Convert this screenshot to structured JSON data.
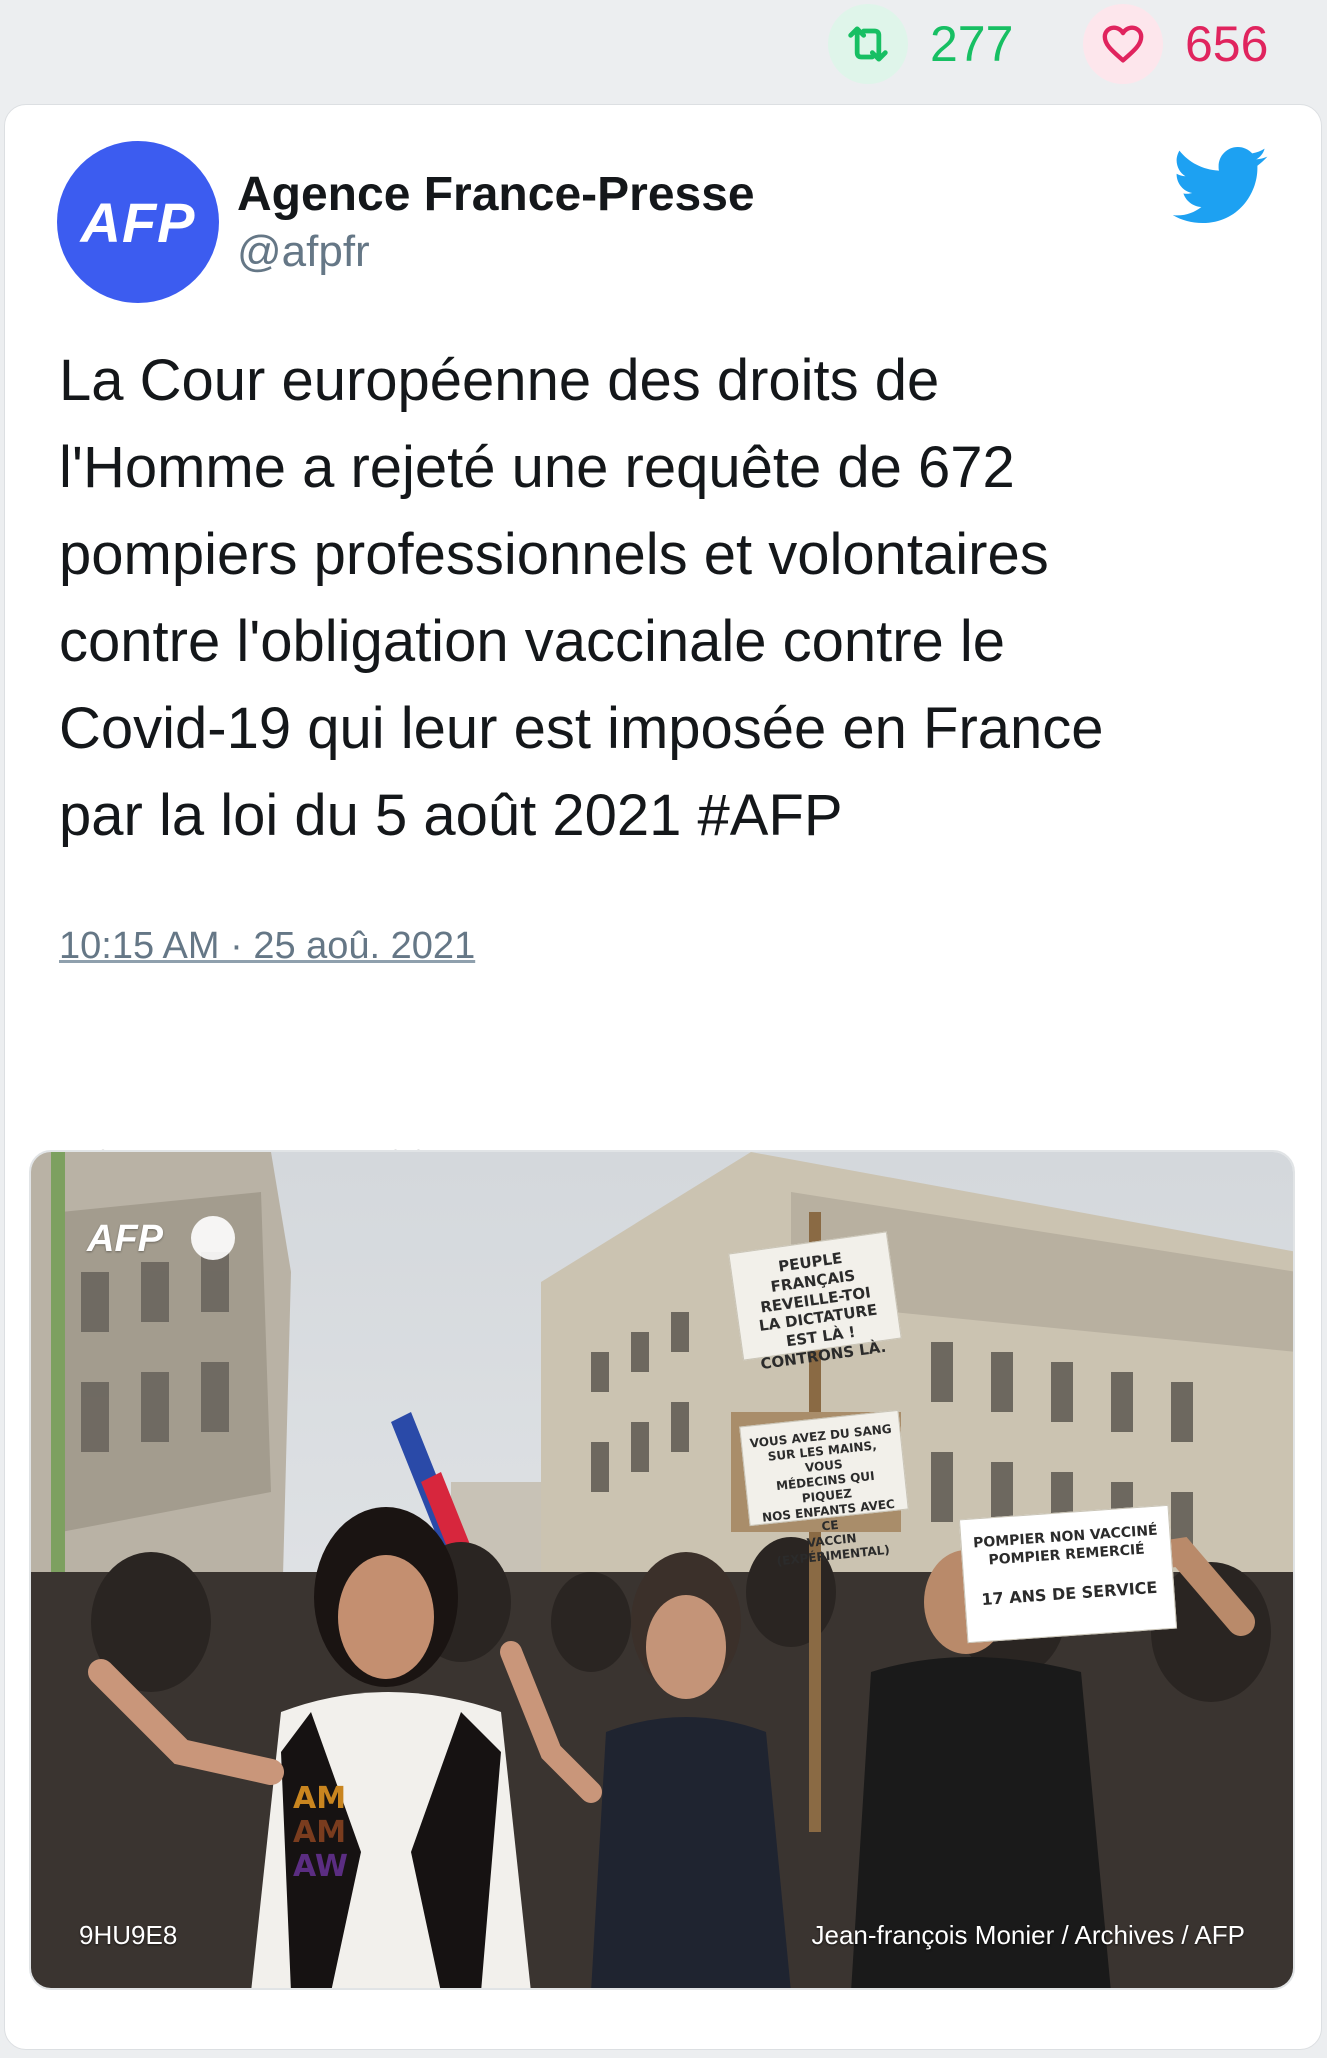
{
  "stats": {
    "retweets": "277",
    "likes": "656",
    "retweet_icon": "retweet-icon",
    "like_icon": "heart-icon",
    "retweet_color": "#17bf63",
    "like_color": "#e0245e"
  },
  "tweet": {
    "author_name": "Agence France-Presse",
    "author_handle": "@afpfr",
    "avatar_text": "AFP",
    "avatar_color": "#3c5cf0",
    "platform_icon": "twitter-bird-icon",
    "text_lines": [
      "La Cour européenne des droits de",
      "l'Homme a rejeté une requête de 672",
      "pompiers professionnels et volontaires",
      "contre l'obligation vaccinale contre le",
      "Covid-19 qui leur est imposée en France",
      "par la loi du 5 août 2021 #AFP"
    ],
    "timestamp": "10:15 AM · 25 aoû. 2021",
    "actions": [
      "reply-icon",
      "retweet-icon",
      "like-icon"
    ]
  },
  "media": {
    "watermark": "AFP",
    "photo_code": "9HU9E8",
    "credit": "Jean-françois Monier / Archives / AFP",
    "sign1": [
      "PEUPLE FRANÇAIS",
      "REVEILLE-TOI",
      "LA DICTATURE EST LÀ !",
      "CONTRONS LÀ."
    ],
    "sign2": [
      "VOUS AVEZ DU SANG",
      "SUR LES MAINS, VOUS",
      "MÉDECINS QUI PIQUEZ",
      "NOS ENFANTS AVEC CE",
      "VACCIN (EXPÉRIMENTAL)"
    ],
    "sign3": [
      "POMPIER NON VACCINÉ",
      "POMPIER REMERCIÉ",
      "17 ANS DE SERVICE"
    ],
    "shirt_text": [
      "AM",
      "AM",
      "AW"
    ]
  }
}
